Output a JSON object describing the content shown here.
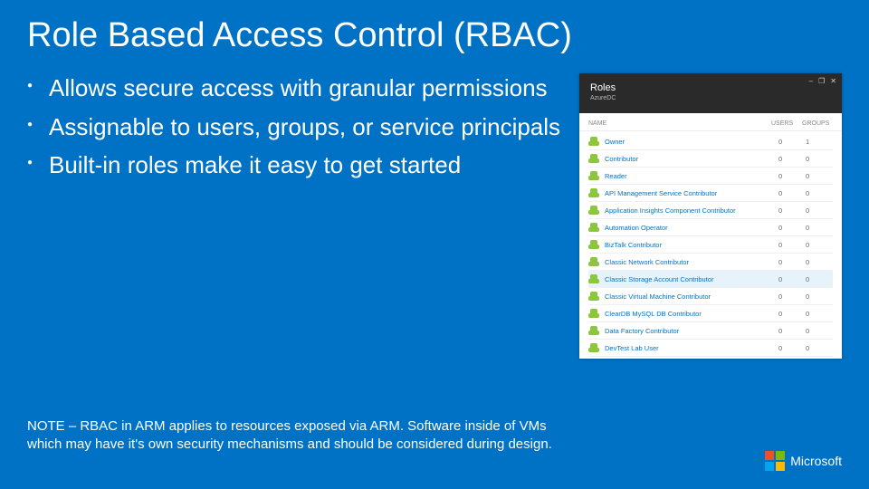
{
  "title": "Role Based Access Control (RBAC)",
  "bullets": [
    "Allows secure access with granular permissions",
    "Assignable to users, groups, or service principals",
    "Built-in roles make it easy to get started"
  ],
  "note": "NOTE – RBAC in ARM applies to resources exposed via ARM. Software inside of VMs which may have it's own security mechanisms and should be considered during design.",
  "logo_label": "Microsoft",
  "panel": {
    "header_title": "Roles",
    "header_subtitle": "AzureDC",
    "window_controls": [
      "–",
      "❐",
      "✕"
    ],
    "columns": {
      "name": "NAME",
      "users": "USERS",
      "groups": "GROUPS"
    },
    "highlighted_index": 7,
    "roles": [
      {
        "name": "Owner",
        "users": "0",
        "groups": "1"
      },
      {
        "name": "Contributor",
        "users": "0",
        "groups": "0"
      },
      {
        "name": "Reader",
        "users": "0",
        "groups": "0"
      },
      {
        "name": "API Management Service Contributor",
        "users": "0",
        "groups": "0"
      },
      {
        "name": "Application Insights Component Contributor",
        "users": "0",
        "groups": "0"
      },
      {
        "name": "Automation Operator",
        "users": "0",
        "groups": "0"
      },
      {
        "name": "BizTalk Contributor",
        "users": "0",
        "groups": "0"
      },
      {
        "name": "Classic Network Contributor",
        "users": "0",
        "groups": "0"
      },
      {
        "name": "Classic Storage Account Contributor",
        "users": "0",
        "groups": "0"
      },
      {
        "name": "Classic Virtual Machine Contributor",
        "users": "0",
        "groups": "0"
      },
      {
        "name": "ClearDB MySQL DB Contributor",
        "users": "0",
        "groups": "0"
      },
      {
        "name": "Data Factory Contributor",
        "users": "0",
        "groups": "0"
      },
      {
        "name": "DevTest Lab User",
        "users": "0",
        "groups": "0"
      }
    ]
  }
}
